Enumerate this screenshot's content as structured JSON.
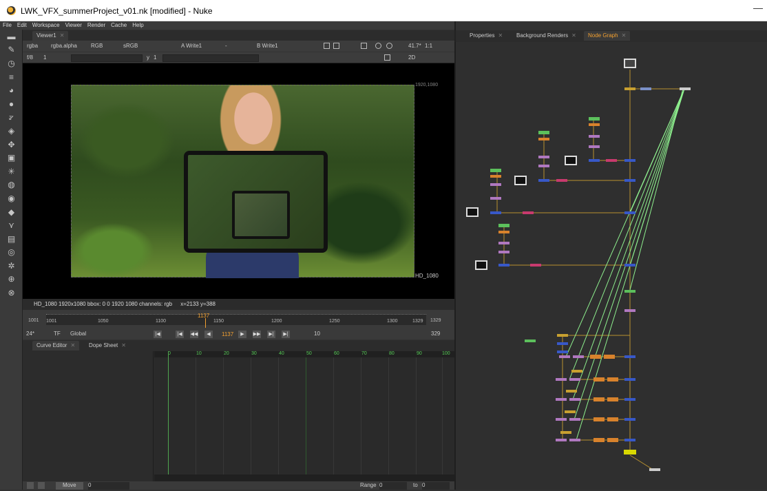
{
  "window": {
    "title": "LWK_VFX_summerProject_v01.nk [modified] - Nuke",
    "minimize": "—"
  },
  "menu": [
    "File",
    "Edit",
    "Workspace",
    "Viewer",
    "Render",
    "Cache",
    "Help"
  ],
  "viewer": {
    "tab": "Viewer1",
    "channels": "rgba",
    "alpha": "rgba.alpha",
    "colorspace": "RGB",
    "lut": "sRGB",
    "a_input": "A  Write1",
    "a_op": "-",
    "b_input": "B  Write1",
    "zoom": "41.7*",
    "ratio": "1:1",
    "fstop": "f/8",
    "frame_step": "1",
    "y_label": "y",
    "y_value": "1",
    "mode": "2D",
    "res_top": "1920,1080",
    "res_bottom": "HD_1080",
    "info_format": "HD_1080 1920x1080  bbox: 0 0 1920 1080 channels: rgb",
    "info_coords": "x=2133 y=388"
  },
  "timeline": {
    "start": "1001",
    "end": "1329",
    "current": "1137",
    "ticks": [
      "1001",
      "1050",
      "1100",
      "1150",
      "1200",
      "1250",
      "1300",
      "1329"
    ],
    "fps": "24*",
    "tf": "TF",
    "scope": "Global",
    "increment": "10",
    "frame_count": "329"
  },
  "curve_panel": {
    "tabs": [
      "Curve Editor",
      "Dope Sheet"
    ],
    "ruler": [
      "0",
      "10",
      "20",
      "30",
      "40",
      "50",
      "60",
      "70",
      "80",
      "90",
      "100"
    ],
    "move_label": "Move",
    "move_value": "0",
    "range_label": "Range",
    "range_start": "0",
    "range_to": "to",
    "range_end": "0"
  },
  "right_panel": {
    "tabs": [
      "Properties",
      "Background Renders",
      "Node Graph"
    ],
    "active": "Node Graph"
  },
  "colors": {
    "accent": "#f2a030",
    "node_blue": "#3858c8",
    "node_pink": "#c83a6e",
    "node_green": "#5cc05c",
    "node_orange": "#d8822c",
    "node_purple": "#b078c0",
    "node_gold": "#c8a030",
    "link_green": "#8ef08e"
  }
}
